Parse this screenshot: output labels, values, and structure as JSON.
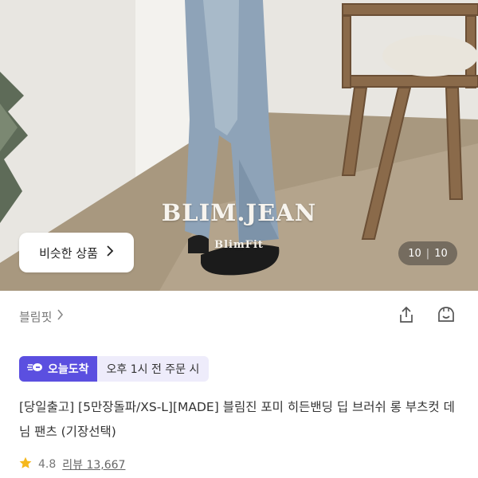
{
  "gallery": {
    "watermark_title": "BLIM.JEAN",
    "watermark_subtitle": "BlimFit",
    "similar_button_label": "비슷한 상품",
    "counter_current": "10",
    "counter_separator": "|",
    "counter_total": "10"
  },
  "store": {
    "name": "블림핏",
    "actions": [
      {
        "icon": "share-icon"
      },
      {
        "icon": "store-icon"
      }
    ]
  },
  "delivery": {
    "badge_label": "오늘도착",
    "time_text": "오후 1시 전 주문 시",
    "badge_color": "#5b4fe0"
  },
  "product": {
    "title": "[당일출고] [5만장돌파/XS-L][MADE] 블림진 포미 히든밴딩 딥 브러쉬 롱 부츠컷 데님 팬츠 (기장선택)"
  },
  "rating": {
    "score": "4.8",
    "review_text": "리뷰 13,667",
    "star_color": "#f5b81c"
  }
}
